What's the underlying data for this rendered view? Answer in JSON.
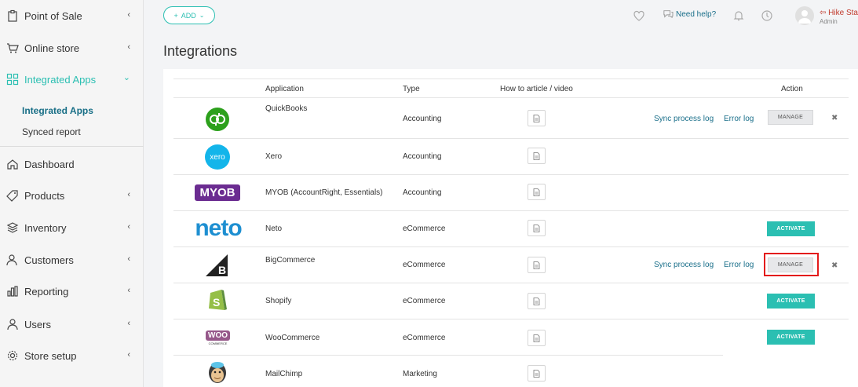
{
  "sidebar": {
    "items": [
      {
        "label": "Point of Sale",
        "icon": "clipboard-icon",
        "chevron": "‹"
      },
      {
        "label": "Online store",
        "icon": "cart-icon",
        "chevron": "‹"
      },
      {
        "label": "Integrated Apps",
        "icon": "apps-grid-icon",
        "chevron": "⌄"
      },
      {
        "label": "Dashboard",
        "icon": "home-icon"
      },
      {
        "label": "Products",
        "icon": "tag-icon",
        "chevron": "‹"
      },
      {
        "label": "Inventory",
        "icon": "layers-icon",
        "chevron": "‹"
      },
      {
        "label": "Customers",
        "icon": "customers-icon",
        "chevron": "‹"
      },
      {
        "label": "Reporting",
        "icon": "bar-chart-icon",
        "chevron": "‹"
      },
      {
        "label": "Users",
        "icon": "user-icon",
        "chevron": "‹"
      },
      {
        "label": "Store setup",
        "icon": "gear-icon",
        "chevron": "‹"
      }
    ],
    "sub_items": [
      {
        "label": "Integrated Apps"
      },
      {
        "label": "Synced report"
      }
    ]
  },
  "header": {
    "add_label": "ADD",
    "help_label": "Need help?",
    "user_name": "Hike Sta",
    "user_role": "Admin"
  },
  "page_title": "Integrations",
  "table": {
    "headers": {
      "application": "Application",
      "type": "Type",
      "howto": "How to article / video",
      "action": "Action"
    },
    "rows": [
      {
        "name": "QuickBooks",
        "type": "Accounting",
        "logo": "quickbooks-logo",
        "sync_log": "Sync process log",
        "error_log": "Error log",
        "button": "MANAGE"
      },
      {
        "name": "Xero",
        "type": "Accounting",
        "logo": "xero-logo",
        "logo_text": "xero"
      },
      {
        "name": "MYOB (AccountRight, Essentials)",
        "type": "Accounting",
        "logo": "myob-logo",
        "logo_text": "MYOB"
      },
      {
        "name": "Neto",
        "type": "eCommerce",
        "logo": "neto-logo",
        "logo_text": "neto",
        "button": "ACTIVATE"
      },
      {
        "name": "BigCommerce",
        "type": "eCommerce",
        "logo": "bigcommerce-logo",
        "sync_log": "Sync process log",
        "error_log": "Error log",
        "button": "MANAGE"
      },
      {
        "name": "Shopify",
        "type": "eCommerce",
        "logo": "shopify-logo",
        "button": "ACTIVATE"
      },
      {
        "name": "WooCommerce",
        "type": "eCommerce",
        "logo": "woocommerce-logo",
        "logo_text": "WOO",
        "logo_subtext": "COMMERCE",
        "button": "ACTIVATE"
      },
      {
        "name": "MailChimp",
        "type": "Marketing",
        "logo": "mailchimp-logo"
      }
    ]
  },
  "colors": {
    "accent": "#2bbfb2",
    "link": "#1a6f8a",
    "highlight": "#e31b1b"
  }
}
